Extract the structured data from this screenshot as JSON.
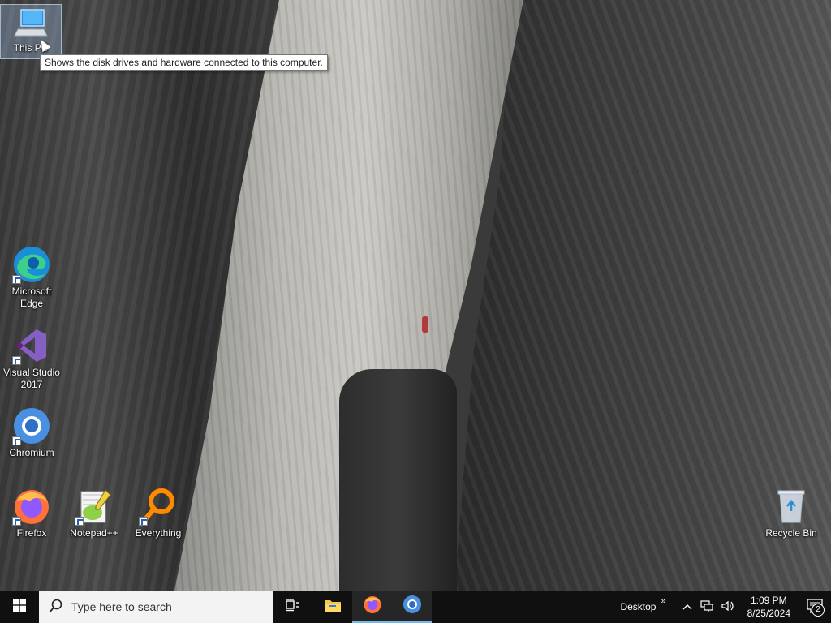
{
  "desktop": {
    "icons": [
      {
        "label": "This PC"
      },
      {
        "label": "Microsoft Edge"
      },
      {
        "label": "Visual Studio 2017"
      },
      {
        "label": "Chromium"
      },
      {
        "label": "Firefox"
      },
      {
        "label": "Notepad++"
      },
      {
        "label": "Everything"
      },
      {
        "label": "Recycle Bin"
      }
    ],
    "tooltip": "Shows the disk drives and hardware connected to this computer."
  },
  "taskbar": {
    "search_placeholder": "Type here to search",
    "toolbar_label": "Desktop",
    "time": "1:09 PM",
    "date": "8/25/2024",
    "notification_count": "2"
  },
  "icon_names": {
    "start": "windows-logo-icon",
    "search": "search-icon",
    "task_view": "task-view-icon",
    "file_explorer": "folder-icon",
    "firefox": "firefox-icon",
    "chromium": "chromium-icon",
    "tray_chevron": "chevron-up-icon",
    "network": "network-icon",
    "volume": "speaker-icon",
    "notifications": "action-center-icon"
  },
  "colors": {
    "taskbar": "#101010",
    "accent": "#76b9ed"
  }
}
